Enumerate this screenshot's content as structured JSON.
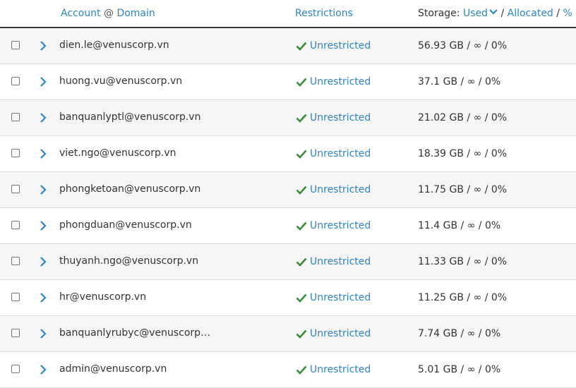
{
  "header": {
    "account": "Account",
    "at": "@",
    "domain": "Domain",
    "restrictions": "Restrictions",
    "storage": "Storage:",
    "used": "Used",
    "slash1": "/",
    "allocated": "Allocated",
    "slash2": "/",
    "percent": "%"
  },
  "colors": {
    "link": "#2d86c3",
    "check": "#3c8a3c",
    "header_border": "#3a3a3a",
    "row_alt": "#f6f6f6"
  },
  "rows": [
    {
      "account": "dien.le@venuscorp.vn",
      "restriction": "Unrestricted",
      "storage": "56.93 GB / ∞ / 0%"
    },
    {
      "account": "huong.vu@venuscorp.vn",
      "restriction": "Unrestricted",
      "storage": "37.1 GB / ∞ / 0%"
    },
    {
      "account": "banquanlyptl@venuscorp.vn",
      "restriction": "Unrestricted",
      "storage": "21.02 GB / ∞ / 0%"
    },
    {
      "account": "viet.ngo@venuscorp.vn",
      "restriction": "Unrestricted",
      "storage": "18.39 GB / ∞ / 0%"
    },
    {
      "account": "phongketoan@venuscorp.vn",
      "restriction": "Unrestricted",
      "storage": "11.75 GB / ∞ / 0%"
    },
    {
      "account": "phongduan@venuscorp.vn",
      "restriction": "Unrestricted",
      "storage": "11.4 GB / ∞ / 0%"
    },
    {
      "account": "thuyanh.ngo@venuscorp.vn",
      "restriction": "Unrestricted",
      "storage": "11.33 GB / ∞ / 0%"
    },
    {
      "account": "hr@venuscorp.vn",
      "restriction": "Unrestricted",
      "storage": "11.25 GB / ∞ / 0%"
    },
    {
      "account": "banquanlyrubyc@venuscorp…",
      "restriction": "Unrestricted",
      "storage": "7.74 GB / ∞ / 0%"
    },
    {
      "account": "admin@venuscorp.vn",
      "restriction": "Unrestricted",
      "storage": "5.01 GB / ∞ / 0%"
    }
  ]
}
